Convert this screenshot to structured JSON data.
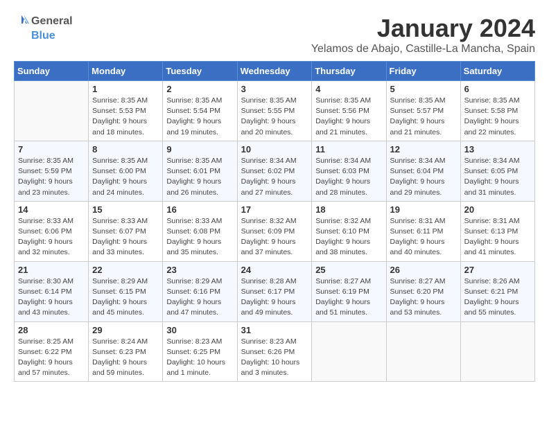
{
  "logo": {
    "text_general": "General",
    "text_blue": "Blue"
  },
  "title": "January 2024",
  "location": "Yelamos de Abajo, Castille-La Mancha, Spain",
  "days_of_week": [
    "Sunday",
    "Monday",
    "Tuesday",
    "Wednesday",
    "Thursday",
    "Friday",
    "Saturday"
  ],
  "weeks": [
    [
      {
        "day": "",
        "info": ""
      },
      {
        "day": "1",
        "info": "Sunrise: 8:35 AM\nSunset: 5:53 PM\nDaylight: 9 hours\nand 18 minutes."
      },
      {
        "day": "2",
        "info": "Sunrise: 8:35 AM\nSunset: 5:54 PM\nDaylight: 9 hours\nand 19 minutes."
      },
      {
        "day": "3",
        "info": "Sunrise: 8:35 AM\nSunset: 5:55 PM\nDaylight: 9 hours\nand 20 minutes."
      },
      {
        "day": "4",
        "info": "Sunrise: 8:35 AM\nSunset: 5:56 PM\nDaylight: 9 hours\nand 21 minutes."
      },
      {
        "day": "5",
        "info": "Sunrise: 8:35 AM\nSunset: 5:57 PM\nDaylight: 9 hours\nand 21 minutes."
      },
      {
        "day": "6",
        "info": "Sunrise: 8:35 AM\nSunset: 5:58 PM\nDaylight: 9 hours\nand 22 minutes."
      }
    ],
    [
      {
        "day": "7",
        "info": "Sunrise: 8:35 AM\nSunset: 5:59 PM\nDaylight: 9 hours\nand 23 minutes."
      },
      {
        "day": "8",
        "info": "Sunrise: 8:35 AM\nSunset: 6:00 PM\nDaylight: 9 hours\nand 24 minutes."
      },
      {
        "day": "9",
        "info": "Sunrise: 8:35 AM\nSunset: 6:01 PM\nDaylight: 9 hours\nand 26 minutes."
      },
      {
        "day": "10",
        "info": "Sunrise: 8:34 AM\nSunset: 6:02 PM\nDaylight: 9 hours\nand 27 minutes."
      },
      {
        "day": "11",
        "info": "Sunrise: 8:34 AM\nSunset: 6:03 PM\nDaylight: 9 hours\nand 28 minutes."
      },
      {
        "day": "12",
        "info": "Sunrise: 8:34 AM\nSunset: 6:04 PM\nDaylight: 9 hours\nand 29 minutes."
      },
      {
        "day": "13",
        "info": "Sunrise: 8:34 AM\nSunset: 6:05 PM\nDaylight: 9 hours\nand 31 minutes."
      }
    ],
    [
      {
        "day": "14",
        "info": "Sunrise: 8:33 AM\nSunset: 6:06 PM\nDaylight: 9 hours\nand 32 minutes."
      },
      {
        "day": "15",
        "info": "Sunrise: 8:33 AM\nSunset: 6:07 PM\nDaylight: 9 hours\nand 33 minutes."
      },
      {
        "day": "16",
        "info": "Sunrise: 8:33 AM\nSunset: 6:08 PM\nDaylight: 9 hours\nand 35 minutes."
      },
      {
        "day": "17",
        "info": "Sunrise: 8:32 AM\nSunset: 6:09 PM\nDaylight: 9 hours\nand 37 minutes."
      },
      {
        "day": "18",
        "info": "Sunrise: 8:32 AM\nSunset: 6:10 PM\nDaylight: 9 hours\nand 38 minutes."
      },
      {
        "day": "19",
        "info": "Sunrise: 8:31 AM\nSunset: 6:11 PM\nDaylight: 9 hours\nand 40 minutes."
      },
      {
        "day": "20",
        "info": "Sunrise: 8:31 AM\nSunset: 6:13 PM\nDaylight: 9 hours\nand 41 minutes."
      }
    ],
    [
      {
        "day": "21",
        "info": "Sunrise: 8:30 AM\nSunset: 6:14 PM\nDaylight: 9 hours\nand 43 minutes."
      },
      {
        "day": "22",
        "info": "Sunrise: 8:29 AM\nSunset: 6:15 PM\nDaylight: 9 hours\nand 45 minutes."
      },
      {
        "day": "23",
        "info": "Sunrise: 8:29 AM\nSunset: 6:16 PM\nDaylight: 9 hours\nand 47 minutes."
      },
      {
        "day": "24",
        "info": "Sunrise: 8:28 AM\nSunset: 6:17 PM\nDaylight: 9 hours\nand 49 minutes."
      },
      {
        "day": "25",
        "info": "Sunrise: 8:27 AM\nSunset: 6:19 PM\nDaylight: 9 hours\nand 51 minutes."
      },
      {
        "day": "26",
        "info": "Sunrise: 8:27 AM\nSunset: 6:20 PM\nDaylight: 9 hours\nand 53 minutes."
      },
      {
        "day": "27",
        "info": "Sunrise: 8:26 AM\nSunset: 6:21 PM\nDaylight: 9 hours\nand 55 minutes."
      }
    ],
    [
      {
        "day": "28",
        "info": "Sunrise: 8:25 AM\nSunset: 6:22 PM\nDaylight: 9 hours\nand 57 minutes."
      },
      {
        "day": "29",
        "info": "Sunrise: 8:24 AM\nSunset: 6:23 PM\nDaylight: 9 hours\nand 59 minutes."
      },
      {
        "day": "30",
        "info": "Sunrise: 8:23 AM\nSunset: 6:25 PM\nDaylight: 10 hours\nand 1 minute."
      },
      {
        "day": "31",
        "info": "Sunrise: 8:23 AM\nSunset: 6:26 PM\nDaylight: 10 hours\nand 3 minutes."
      },
      {
        "day": "",
        "info": ""
      },
      {
        "day": "",
        "info": ""
      },
      {
        "day": "",
        "info": ""
      }
    ]
  ]
}
